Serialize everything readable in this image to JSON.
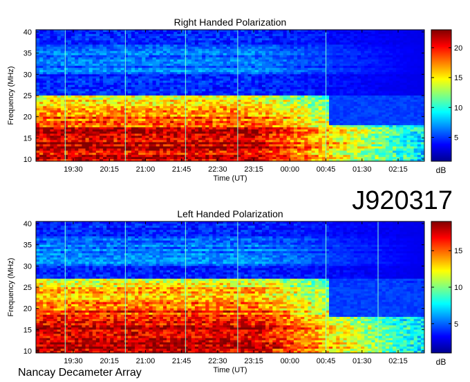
{
  "figure": {
    "observation_id": "J920317",
    "instrument": "Nancay Decameter Array"
  },
  "chart_data": [
    {
      "type": "heatmap",
      "title": "Right Handed Polarization",
      "xlabel": "Time (UT)",
      "ylabel": "Frequency (MHz)",
      "x_ticks": [
        "19:30",
        "20:15",
        "21:00",
        "21:45",
        "22:30",
        "23:15",
        "00:00",
        "00:45",
        "01:30",
        "02:15"
      ],
      "y_ticks": [
        10,
        15,
        20,
        25,
        30,
        35,
        40
      ],
      "ylim": [
        9.5,
        40.5
      ],
      "colorbar": {
        "label": "dB",
        "ticks": [
          5,
          10,
          15,
          20
        ],
        "range": [
          1,
          23
        ],
        "colormap": "jet"
      },
      "emission_summary": {
        "description": "Strong emission 10-25 MHz from start to ~23:15 UT, fading toward 02:30 UT",
        "vertical_artifacts_at": [
          "19:20",
          "20:35",
          "21:50",
          "22:55",
          "00:45"
        ]
      }
    },
    {
      "type": "heatmap",
      "title": "Left Handed Polarization",
      "xlabel": "Time (UT)",
      "ylabel": "Frequency (MHz)",
      "x_ticks": [
        "19:30",
        "20:15",
        "21:00",
        "21:45",
        "22:30",
        "23:15",
        "00:00",
        "00:45",
        "01:30",
        "02:15"
      ],
      "y_ticks": [
        10,
        15,
        20,
        25,
        30,
        35,
        40
      ],
      "ylim": [
        9.5,
        40.5
      ],
      "colorbar": {
        "label": "dB",
        "ticks": [
          5,
          10,
          15
        ],
        "range": [
          1,
          19
        ],
        "colormap": "jet"
      },
      "emission_summary": {
        "description": "Strong emission 10-27 MHz from start to ~23:15 UT, fading toward 02:30 UT",
        "vertical_artifacts_at": [
          "19:20",
          "20:35",
          "21:50",
          "22:55",
          "00:45",
          "01:50"
        ]
      }
    }
  ]
}
